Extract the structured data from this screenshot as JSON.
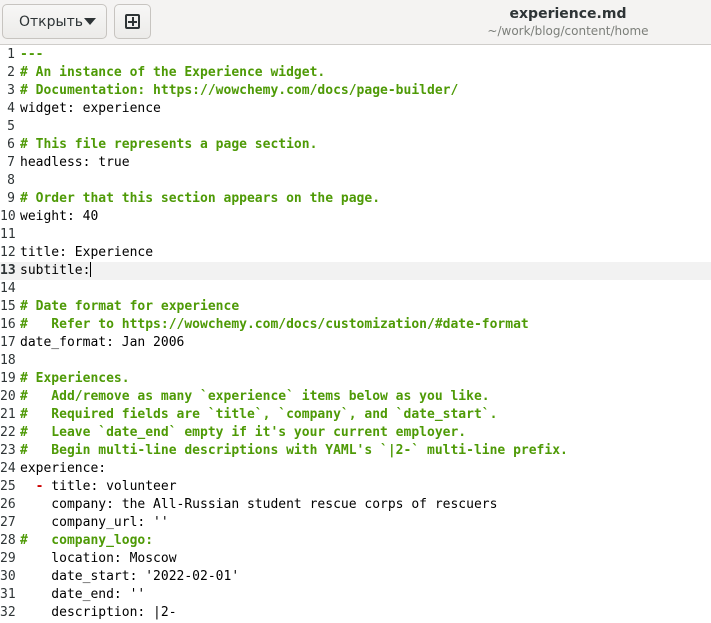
{
  "header": {
    "open_label": "Открыть",
    "file_name": "experience.md",
    "file_path": "~/work/blog/content/home"
  },
  "editor": {
    "current_line": 13,
    "lines": [
      {
        "n": "1",
        "segs": [
          {
            "t": "---",
            "k": "comment"
          }
        ]
      },
      {
        "n": "2",
        "segs": [
          {
            "t": "# An instance of the Experience widget.",
            "k": "comment"
          }
        ]
      },
      {
        "n": "3",
        "segs": [
          {
            "t": "# Documentation: https://wowchemy.com/docs/page-builder/",
            "k": "comment"
          }
        ]
      },
      {
        "n": "4",
        "segs": [
          {
            "t": "widget: experience",
            "k": "plain"
          }
        ]
      },
      {
        "n": "5",
        "segs": []
      },
      {
        "n": "6",
        "segs": [
          {
            "t": "# This file represents a page section.",
            "k": "comment"
          }
        ]
      },
      {
        "n": "7",
        "segs": [
          {
            "t": "headless: true",
            "k": "plain"
          }
        ]
      },
      {
        "n": "8",
        "segs": []
      },
      {
        "n": "9",
        "segs": [
          {
            "t": "# Order that this section appears on the page.",
            "k": "comment"
          }
        ]
      },
      {
        "n": "10",
        "segs": [
          {
            "t": "weight: 40",
            "k": "plain"
          }
        ]
      },
      {
        "n": "11",
        "segs": []
      },
      {
        "n": "12",
        "segs": [
          {
            "t": "title: Experience",
            "k": "plain"
          }
        ]
      },
      {
        "n": "13",
        "segs": [
          {
            "t": "subtitle:",
            "k": "plain"
          }
        ],
        "cursor": true
      },
      {
        "n": "14",
        "segs": []
      },
      {
        "n": "15",
        "segs": [
          {
            "t": "# Date format for experience",
            "k": "comment"
          }
        ]
      },
      {
        "n": "16",
        "segs": [
          {
            "t": "#   Refer to https://wowchemy.com/docs/customization/#date-format",
            "k": "comment"
          }
        ]
      },
      {
        "n": "17",
        "segs": [
          {
            "t": "date_format: Jan 2006",
            "k": "plain"
          }
        ]
      },
      {
        "n": "18",
        "segs": []
      },
      {
        "n": "19",
        "segs": [
          {
            "t": "# Experiences.",
            "k": "comment"
          }
        ]
      },
      {
        "n": "20",
        "segs": [
          {
            "t": "#   Add/remove as many `experience` items below as you like.",
            "k": "comment"
          }
        ]
      },
      {
        "n": "21",
        "segs": [
          {
            "t": "#   Required fields are `title`, `company`, and `date_start`.",
            "k": "comment"
          }
        ]
      },
      {
        "n": "22",
        "segs": [
          {
            "t": "#   Leave `date_end` empty if it's your current employer.",
            "k": "comment"
          }
        ]
      },
      {
        "n": "23",
        "segs": [
          {
            "t": "#   Begin multi-line descriptions with YAML's `|2-` multi-line prefix.",
            "k": "comment"
          }
        ]
      },
      {
        "n": "24",
        "segs": [
          {
            "t": "experience:",
            "k": "plain"
          }
        ]
      },
      {
        "n": "25",
        "segs": [
          {
            "t": "  ",
            "k": "plain"
          },
          {
            "t": "-",
            "k": "dash"
          },
          {
            "t": " title: volunteer",
            "k": "plain"
          }
        ]
      },
      {
        "n": "26",
        "segs": [
          {
            "t": "    company: the All-Russian student rescue corps of rescuers",
            "k": "plain"
          }
        ]
      },
      {
        "n": "27",
        "segs": [
          {
            "t": "    company_url: ''",
            "k": "plain"
          }
        ]
      },
      {
        "n": "28",
        "segs": [
          {
            "t": "#   company_logo:",
            "k": "comment"
          }
        ]
      },
      {
        "n": "29",
        "segs": [
          {
            "t": "    location: Moscow",
            "k": "plain"
          }
        ]
      },
      {
        "n": "30",
        "segs": [
          {
            "t": "    date_start: '2022-02-01'",
            "k": "plain"
          }
        ]
      },
      {
        "n": "31",
        "segs": [
          {
            "t": "    date_end: ''",
            "k": "plain"
          }
        ]
      },
      {
        "n": "32",
        "segs": [
          {
            "t": "    description: |2-",
            "k": "plain"
          }
        ]
      }
    ]
  }
}
